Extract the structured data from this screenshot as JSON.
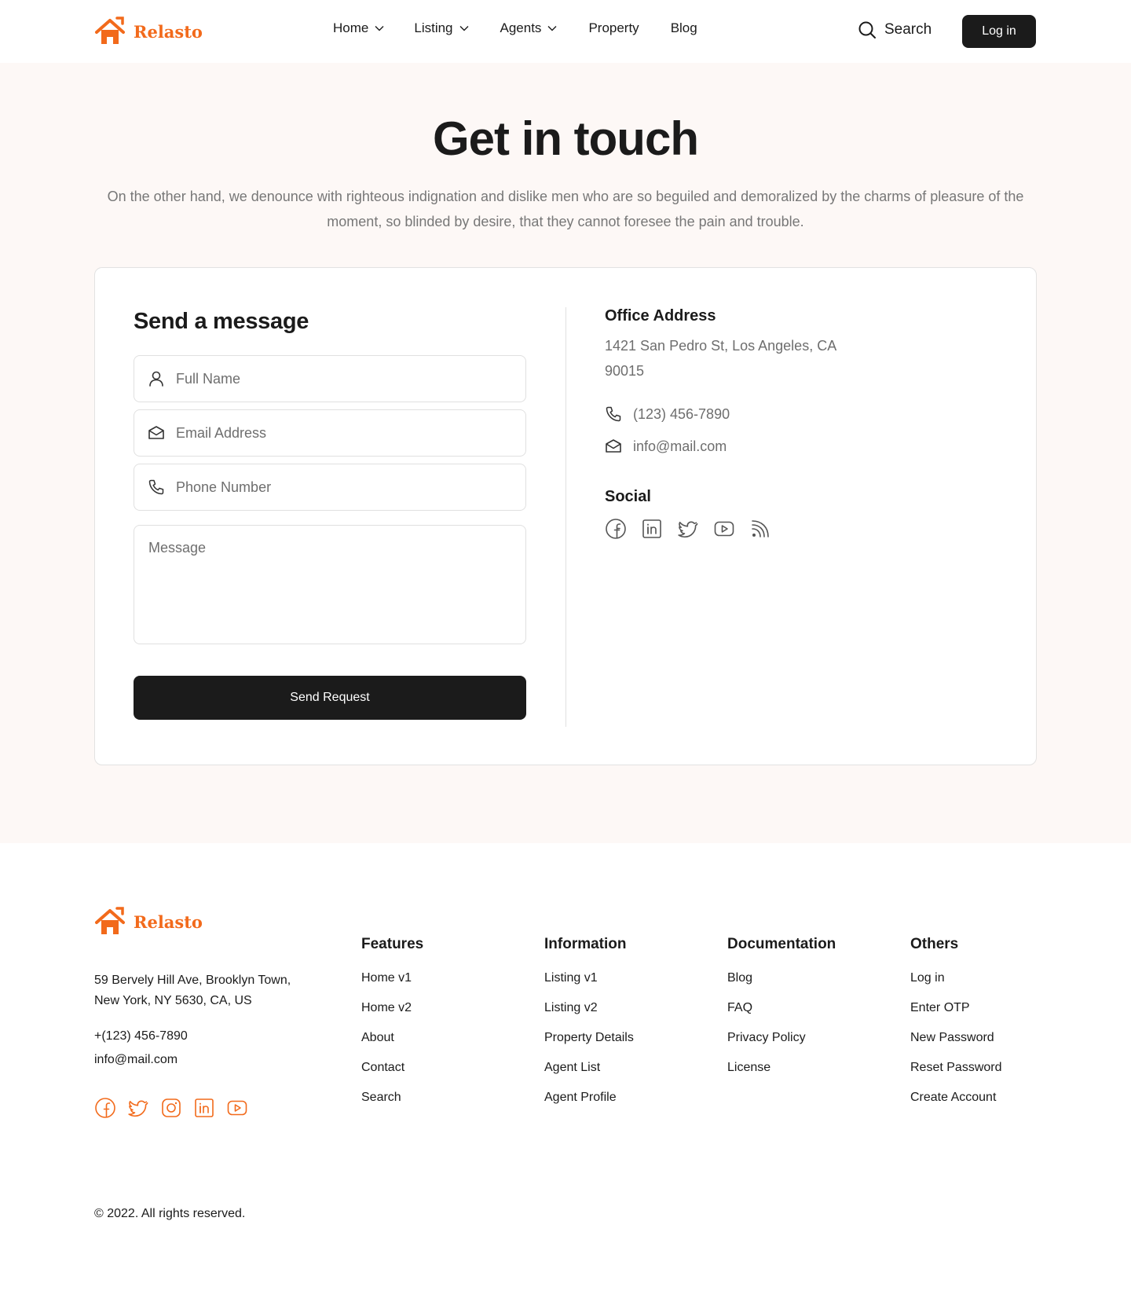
{
  "brand": {
    "name": "Relasto",
    "accent_color": "#f26a1b",
    "dark_color": "#1b1b1b",
    "logo_icon": "house-icon"
  },
  "nav": {
    "items": [
      {
        "label": "Home",
        "has_dropdown": true
      },
      {
        "label": "Listing",
        "has_dropdown": true
      },
      {
        "label": "Agents",
        "has_dropdown": true
      },
      {
        "label": "Property",
        "has_dropdown": false
      },
      {
        "label": "Blog",
        "has_dropdown": false
      }
    ],
    "search_label": "Search",
    "login_label": "Log in"
  },
  "hero": {
    "title": "Get in touch",
    "subtitle": "On the other hand, we denounce with righteous indignation and dislike men who are so beguiled and demoralized by the charms of pleasure of the moment, so blinded by desire, that they cannot foresee the pain and trouble."
  },
  "form": {
    "title": "Send a message",
    "full_name_placeholder": "Full Name",
    "email_placeholder": "Email Address",
    "phone_placeholder": "Phone Number",
    "message_placeholder": "Message",
    "submit_label": "Send Request"
  },
  "office": {
    "title": "Office Address",
    "address": "1421 San Pedro St, Los Angeles, CA 90015",
    "phone": "(123) 456-7890",
    "email": "info@mail.com",
    "social_title": "Social",
    "social_icons": [
      "facebook-icon",
      "linkedin-icon",
      "twitter-icon",
      "youtube-icon",
      "rss-icon"
    ]
  },
  "footer": {
    "address": "59 Bervely Hill Ave, Brooklyn Town, New York, NY 5630, CA, US",
    "phone": "+(123) 456-7890",
    "email": "info@mail.com",
    "social_icons": [
      "facebook-icon",
      "twitter-icon",
      "instagram-icon",
      "linkedin-icon",
      "youtube-icon"
    ],
    "columns": [
      {
        "title": "Features",
        "links": [
          "Home v1",
          "Home v2",
          "About",
          "Contact",
          "Search"
        ]
      },
      {
        "title": "Information",
        "links": [
          "Listing v1",
          "Listing v2",
          "Property Details",
          "Agent List",
          "Agent Profile"
        ]
      },
      {
        "title": "Documentation",
        "links": [
          "Blog",
          "FAQ",
          "Privacy Policy",
          "License"
        ]
      },
      {
        "title": "Others",
        "links": [
          "Log in",
          "Enter OTP",
          "New Password",
          "Reset Password",
          "Create Account"
        ]
      }
    ],
    "copyright": "© 2022. All rights reserved."
  }
}
